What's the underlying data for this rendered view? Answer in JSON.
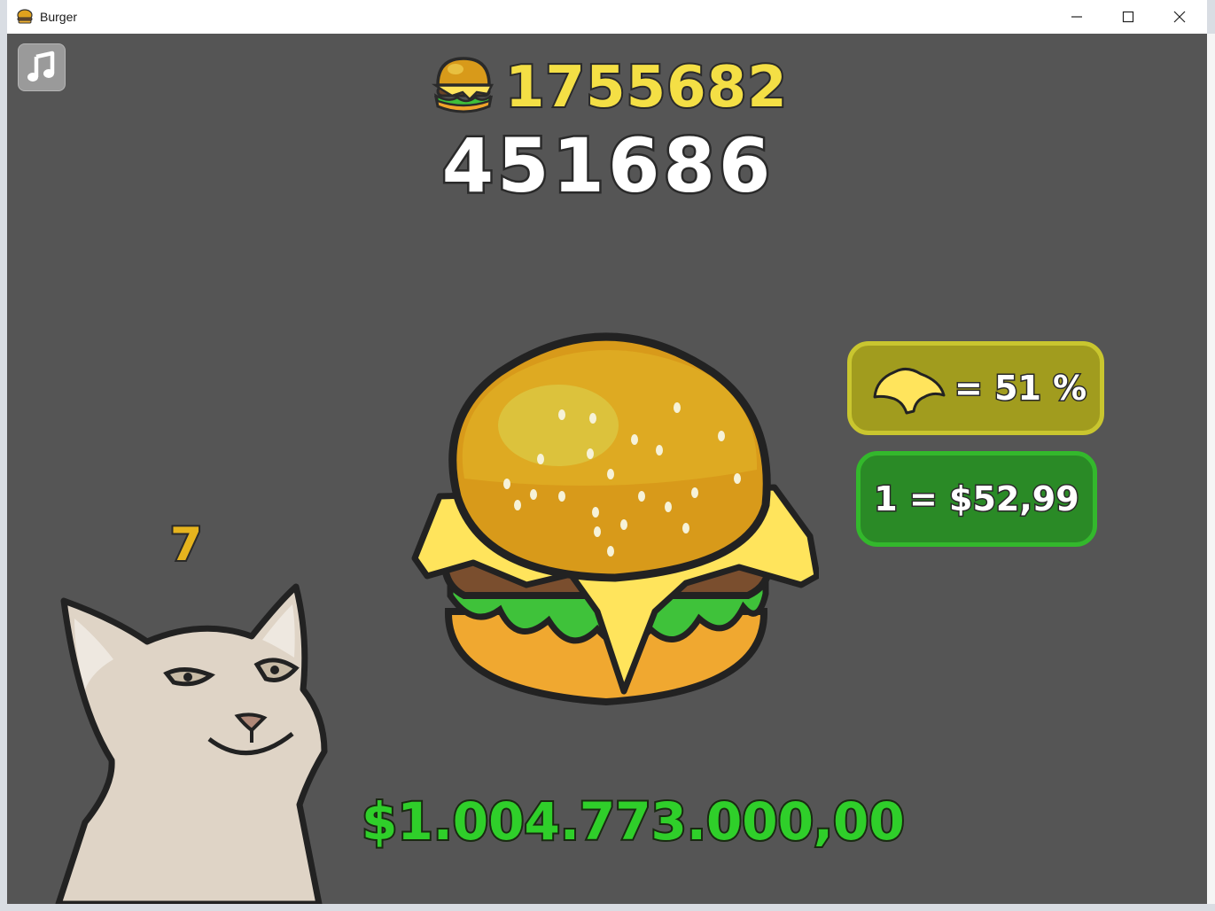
{
  "window": {
    "title": "Burger",
    "icon": "burger-icon"
  },
  "hud": {
    "music_icon": "music-note-icon",
    "total_burgers": "1755682",
    "current_burgers": "451686",
    "money": "$1.004.773.000,00"
  },
  "cheese_panel": {
    "icon": "cheese-icon",
    "value": "= 51 %"
  },
  "price_panel": {
    "value": "1 = $52,99"
  },
  "cat": {
    "count": "7"
  },
  "colors": {
    "background": "#555555",
    "total_count": "#f4df45",
    "money": "#2fcf2a",
    "cheese_panel": "#a19c1e",
    "price_panel": "#2a8a26",
    "cat_count": "#e6b41e"
  }
}
